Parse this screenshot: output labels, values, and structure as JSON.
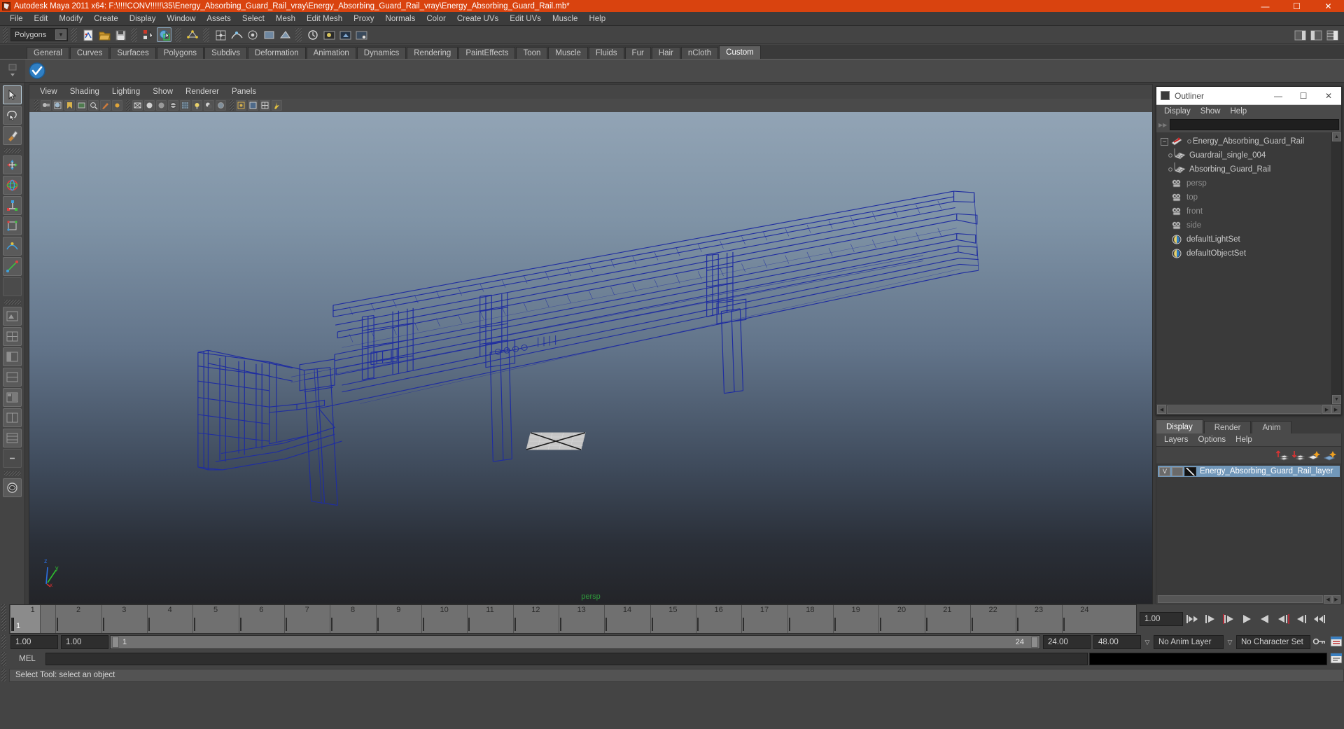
{
  "window": {
    "title": "Autodesk Maya 2011 x64: F:\\!!!!CONV!!!!!\\35\\Energy_Absorbing_Guard_Rail_vray\\Energy_Absorbing_Guard_Rail_vray\\Energy_Absorbing_Guard_Rail.mb*",
    "minimize": "—",
    "maximize": "☐",
    "close": "✕",
    "titlebar_color": "#d9430f"
  },
  "menubar": {
    "items": [
      "File",
      "Edit",
      "Modify",
      "Create",
      "Display",
      "Window",
      "Assets",
      "Select",
      "Mesh",
      "Edit Mesh",
      "Proxy",
      "Normals",
      "Color",
      "Create UVs",
      "Edit UVs",
      "Muscle",
      "Help"
    ]
  },
  "status_line": {
    "menu_set": "Polygons",
    "menu_set_arrow": "▼"
  },
  "shelf": {
    "tabs": [
      "General",
      "Curves",
      "Surfaces",
      "Polygons",
      "Subdivs",
      "Deformation",
      "Animation",
      "Dynamics",
      "Rendering",
      "PaintEffects",
      "Toon",
      "Muscle",
      "Fluids",
      "Fur",
      "Hair",
      "nCloth",
      "Custom"
    ],
    "active_tab": "Custom"
  },
  "viewport": {
    "menus": [
      "View",
      "Shading",
      "Lighting",
      "Show",
      "Renderer",
      "Panels"
    ],
    "camera_label": "persp",
    "camera_label_color": "#2f9c3c",
    "wireframe_color": "#1f2da0",
    "axis": {
      "x": "x",
      "y": "y",
      "z": "z"
    }
  },
  "outliner": {
    "title": "Outliner",
    "minimize": "—",
    "maximize": "☐",
    "close": "✕",
    "menus": [
      "Display",
      "Show",
      "Help"
    ],
    "search_value": "",
    "items": [
      {
        "label": "Energy_Absorbing_Guard_Rail",
        "icon": "transform-icon",
        "depth": 0,
        "expandable": true,
        "expand_glyph": "−",
        "dim": false
      },
      {
        "label": "Guardrail_single_004",
        "icon": "mesh-icon",
        "depth": 1,
        "expandable": false,
        "expand_glyph": "",
        "dim": false
      },
      {
        "label": "Absorbing_Guard_Rail",
        "icon": "mesh-icon",
        "depth": 1,
        "expandable": false,
        "expand_glyph": "",
        "dim": false
      },
      {
        "label": "persp",
        "icon": "camera-icon",
        "depth": 0,
        "expandable": false,
        "expand_glyph": "",
        "dim": true
      },
      {
        "label": "top",
        "icon": "camera-icon",
        "depth": 0,
        "expandable": false,
        "expand_glyph": "",
        "dim": true
      },
      {
        "label": "front",
        "icon": "camera-icon",
        "depth": 0,
        "expandable": false,
        "expand_glyph": "",
        "dim": true
      },
      {
        "label": "side",
        "icon": "camera-icon",
        "depth": 0,
        "expandable": false,
        "expand_glyph": "",
        "dim": true
      },
      {
        "label": "defaultLightSet",
        "icon": "set-icon",
        "depth": 0,
        "expandable": false,
        "expand_glyph": "",
        "dim": false
      },
      {
        "label": "defaultObjectSet",
        "icon": "set-icon",
        "depth": 0,
        "expandable": false,
        "expand_glyph": "",
        "dim": false
      }
    ]
  },
  "layer_editor": {
    "tabs": [
      "Display",
      "Render",
      "Anim"
    ],
    "active_tab": "Display",
    "menus": [
      "Layers",
      "Options",
      "Help"
    ],
    "layers": [
      {
        "visibility": "V",
        "shading": "",
        "name": "Energy_Absorbing_Guard_Rail_layer",
        "selected": true
      }
    ],
    "highlight_color": "#7197b9"
  },
  "time_slider": {
    "tick_labels": [
      "1",
      "2",
      "3",
      "4",
      "5",
      "6",
      "7",
      "8",
      "9",
      "10",
      "11",
      "12",
      "13",
      "14",
      "15",
      "16",
      "17",
      "18",
      "19",
      "20",
      "21",
      "22",
      "23",
      "24"
    ],
    "current_frame": "1",
    "current_time_field": "1.00",
    "playback_buttons": [
      "go-to-start",
      "step-back-key",
      "step-back-frame",
      "play-backwards",
      "play-forwards",
      "step-forward-frame",
      "step-forward-key",
      "go-to-end"
    ]
  },
  "range_slider": {
    "anim_start": "1.00",
    "range_start": "1.00",
    "range_bar_start": "1",
    "range_bar_end": "24",
    "range_end": "24.00",
    "anim_end": "48.00",
    "anim_layer": "No Anim Layer",
    "character_set": "No Character Set"
  },
  "command_line": {
    "label": "MEL",
    "input_value": ""
  },
  "help_line": {
    "text": "Select Tool: select an object"
  }
}
